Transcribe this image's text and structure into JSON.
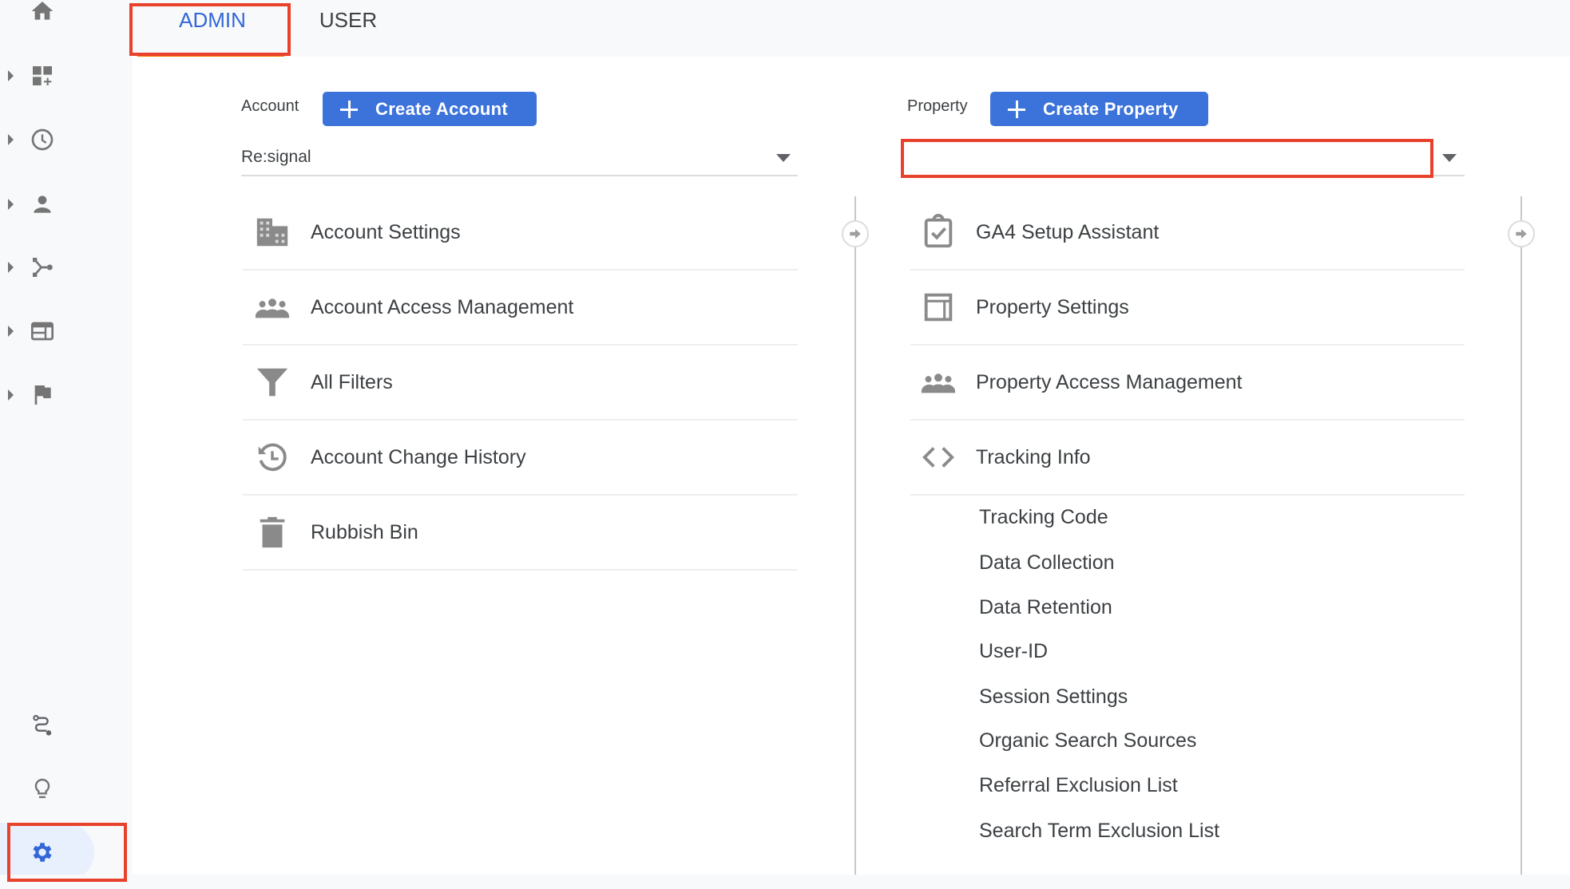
{
  "tabs": [
    {
      "label": "ADMIN",
      "active": true
    },
    {
      "label": "USER",
      "active": false
    }
  ],
  "colors": {
    "accent": "#3367d6",
    "button": "#3b73db",
    "tab_underline": "#f57c00",
    "highlight_box": "#e8412c",
    "icon": "#757575",
    "sidebar_active_bg": "#e8f0fe"
  },
  "sidebar": {
    "top_items": [
      {
        "icon": "home-icon",
        "expandable": false
      },
      {
        "icon": "customization-dashboard-icon",
        "expandable": true
      },
      {
        "icon": "realtime-clock-icon",
        "expandable": true
      },
      {
        "icon": "audience-person-icon",
        "expandable": true
      },
      {
        "icon": "acquisition-branch-icon",
        "expandable": true
      },
      {
        "icon": "behavior-table-icon",
        "expandable": true
      },
      {
        "icon": "conversions-flag-icon",
        "expandable": true
      }
    ],
    "bottom_items": [
      {
        "icon": "attribution-path-icon"
      },
      {
        "icon": "discover-lightbulb-icon"
      },
      {
        "icon": "admin-gear-icon",
        "active": true
      }
    ]
  },
  "account": {
    "label": "Account",
    "create_button": "Create Account",
    "selected": "Re:signal",
    "items": [
      {
        "icon": "building-icon",
        "label": "Account Settings"
      },
      {
        "icon": "people-icon",
        "label": "Account Access Management"
      },
      {
        "icon": "filter-icon",
        "label": "All Filters"
      },
      {
        "icon": "history-icon",
        "label": "Account Change History"
      },
      {
        "icon": "trash-icon",
        "label": "Rubbish Bin"
      }
    ]
  },
  "property": {
    "label": "Property",
    "create_button": "Create Property",
    "selected": "",
    "items": [
      {
        "icon": "clipboard-check-icon",
        "label": "GA4 Setup Assistant"
      },
      {
        "icon": "layout-icon",
        "label": "Property Settings"
      },
      {
        "icon": "people-icon",
        "label": "Property Access Management"
      },
      {
        "icon": "code-icon",
        "label": "Tracking Info"
      }
    ],
    "tracking_sub_items": [
      "Tracking Code",
      "Data Collection",
      "Data Retention",
      "User-ID",
      "Session Settings",
      "Organic Search Sources",
      "Referral Exclusion List",
      "Search Term Exclusion List"
    ]
  }
}
